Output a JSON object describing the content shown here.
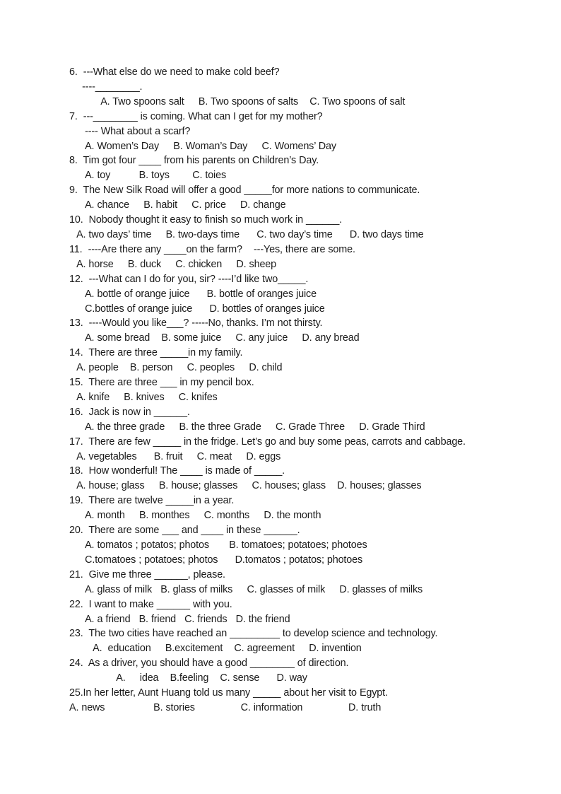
{
  "document": {
    "type": "multiple-choice-grammar-worksheet",
    "page_background": "#ffffff",
    "text_color": "#1a1a1a",
    "questions": [
      {
        "number": "6.",
        "lines": [
          {
            "indent": 0,
            "text": "6.  ---What else do we need to make cold beef?"
          },
          {
            "indent": 1,
            "text": "   ----________."
          },
          {
            "indent": 4,
            "text": "    A. Two spoons salt     B. Two spoons of salts    C. Two spoons of salt"
          }
        ]
      },
      {
        "number": "7.",
        "lines": [
          {
            "indent": 0,
            "text": "7.  ---________ is coming. What can I get for my mother?"
          },
          {
            "indent": 2,
            "text": "  ---- What about a scarf?"
          },
          {
            "indent": 2,
            "text": "  A. Women’s Day     B. Woman’s Day     C. Womens’ Day"
          }
        ]
      },
      {
        "number": "8.",
        "lines": [
          {
            "indent": 0,
            "text": "8.  Tim got four ____ from his parents on Children’s Day."
          },
          {
            "indent": 2,
            "text": "  A. toy          B. toys        C. toies"
          }
        ]
      },
      {
        "number": "9.",
        "lines": [
          {
            "indent": 0,
            "text": "9.  The New Silk Road will offer a good _____for more nations to communicate."
          },
          {
            "indent": 2,
            "text": "  A. chance     B. habit     C. price     D. change"
          }
        ]
      },
      {
        "number": "10.",
        "lines": [
          {
            "indent": 0,
            "text": "10.  Nobody thought it easy to finish so much work in ______."
          },
          {
            "indent": 1,
            "text": " A. two days’ time     B. two-days time      C. two day’s time      D. two days time"
          }
        ]
      },
      {
        "number": "11.",
        "lines": [
          {
            "indent": 0,
            "text": "11.  ----Are there any ____on the farm?    ---Yes, there are some."
          },
          {
            "indent": 1,
            "text": " A. horse     B. duck     C. chicken     D. sheep"
          }
        ]
      },
      {
        "number": "12.",
        "lines": [
          {
            "indent": 0,
            "text": "12.  ---What can I do for you, sir? ----I’d like two_____."
          },
          {
            "indent": 2,
            "text": "  A. bottle of orange juice      B. bottle of oranges juice"
          },
          {
            "indent": 2,
            "text": "  C.bottles of orange juice      D. bottles of oranges juice"
          }
        ]
      },
      {
        "number": "13.",
        "lines": [
          {
            "indent": 0,
            "text": "13.  ----Would you like___? -----No, thanks. I’m not thirsty."
          },
          {
            "indent": 2,
            "text": "  A. some bread    B. some juice     C. any juice     D. any bread"
          }
        ]
      },
      {
        "number": "14.",
        "lines": [
          {
            "indent": 0,
            "text": "14.  There are three _____in my family."
          },
          {
            "indent": 1,
            "text": " A. people    B. person     C. peoples     D. child"
          }
        ]
      },
      {
        "number": "15.",
        "lines": [
          {
            "indent": 0,
            "text": "15.  There are three ___ in my pencil box."
          },
          {
            "indent": 1,
            "text": " A. knife     B. knives     C. knifes"
          }
        ]
      },
      {
        "number": "16.",
        "lines": [
          {
            "indent": 0,
            "text": "16.  Jack is now in ______."
          },
          {
            "indent": 2,
            "text": "  A. the three grade     B. the three Grade     C. Grade Three     D. Grade Third"
          }
        ]
      },
      {
        "number": "17.",
        "lines": [
          {
            "indent": 0,
            "text": "17.  There are few _____ in the fridge. Let’s go and buy some peas, carrots and cabbage."
          },
          {
            "indent": 1,
            "text": " A. vegetables      B. fruit     C. meat     D. eggs"
          }
        ]
      },
      {
        "number": "18.",
        "lines": [
          {
            "indent": 0,
            "text": "18.  How wonderful! The ____ is made of _____."
          },
          {
            "indent": 1,
            "text": " A. house; glass     B. house; glasses     C. houses; glass    D. houses; glasses"
          }
        ]
      },
      {
        "number": "19.",
        "lines": [
          {
            "indent": 0,
            "text": "19.  There are twelve _____in a year."
          },
          {
            "indent": 2,
            "text": "  A. month     B. monthes     C. months     D. the month"
          }
        ]
      },
      {
        "number": "20.",
        "lines": [
          {
            "indent": 0,
            "text": "20.  There are some ___ and ____ in these ______."
          },
          {
            "indent": 2,
            "text": "  A. tomatos ; potatos; photos       B. tomatoes; potatoes; photoes"
          },
          {
            "indent": 2,
            "text": "  C.tomatoes ; potatoes; photos      D.tomatos ; potatos; photoes"
          }
        ]
      },
      {
        "number": "21.",
        "lines": [
          {
            "indent": 0,
            "text": "21.  Give me three ______, please."
          },
          {
            "indent": 2,
            "text": "  A. glass of milk   B. glass of milks     C. glasses of milk     D. glasses of milks"
          }
        ]
      },
      {
        "number": "22.",
        "lines": [
          {
            "indent": 0,
            "text": "22.  I want to make ______ with you."
          },
          {
            "indent": 2,
            "text": "  A. a friend   B. friend   C. friends   D. the friend"
          }
        ]
      },
      {
        "number": "23.",
        "lines": [
          {
            "indent": 0,
            "text": "23.  The two cities have reached an _________ to develop science and technology."
          },
          {
            "indent": 3,
            "text": "   A.  education     B.excitement    C. agreement     D. invention"
          }
        ]
      },
      {
        "number": "24.",
        "lines": [
          {
            "indent": 0,
            "text": "24.  As a driver, you should have a good ________ of direction."
          },
          {
            "indent": 6,
            "text": "     A.     idea    B.feeling    C. sense      D. way"
          }
        ]
      },
      {
        "number": "25.",
        "lines": [
          {
            "indent": 0,
            "text": "25.In her letter, Aunt Huang told us many _____ about her visit to Egypt."
          },
          {
            "indent": 0,
            "text": "A. news                 B. stories                C. information                D. truth"
          }
        ]
      }
    ]
  }
}
